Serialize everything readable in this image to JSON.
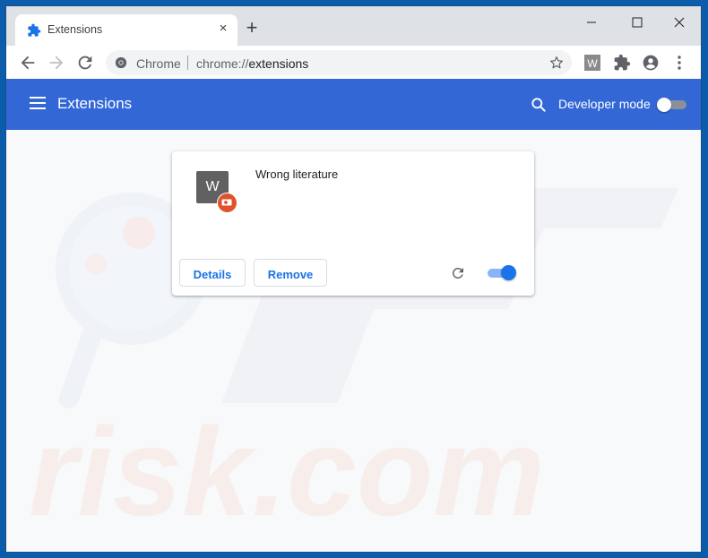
{
  "tab": {
    "title": "Extensions",
    "icon": "puzzle-icon",
    "close_glyph": "×"
  },
  "new_tab_glyph": "+",
  "window_controls": [
    "minimize",
    "maximize",
    "close"
  ],
  "toolbar": {
    "back": "arrow-left-icon",
    "forward": "arrow-right-icon",
    "reload": "reload-icon",
    "omnibox": {
      "chip": "Chrome",
      "url_scheme": "chrome://",
      "url_host": "extensions"
    },
    "bookmark": "star-icon",
    "extension_w_label": "W",
    "extensions_menu": "puzzle-icon",
    "profile": "account-circle-icon",
    "menu": "kebab-menu-icon"
  },
  "header": {
    "title": "Extensions",
    "developer_mode_label": "Developer mode",
    "developer_mode_on": false
  },
  "extensions": [
    {
      "icon_letter": "W",
      "name": "Wrong literature",
      "details_label": "Details",
      "remove_label": "Remove",
      "enabled": true
    }
  ],
  "watermark": {
    "line1": "PC",
    "line2": "risk.com"
  },
  "colors": {
    "header_blue": "#3367d6",
    "toggle_on": "#1a73e8",
    "badge_orange": "#e0522c",
    "desktop_blue": "#0b5cab"
  }
}
